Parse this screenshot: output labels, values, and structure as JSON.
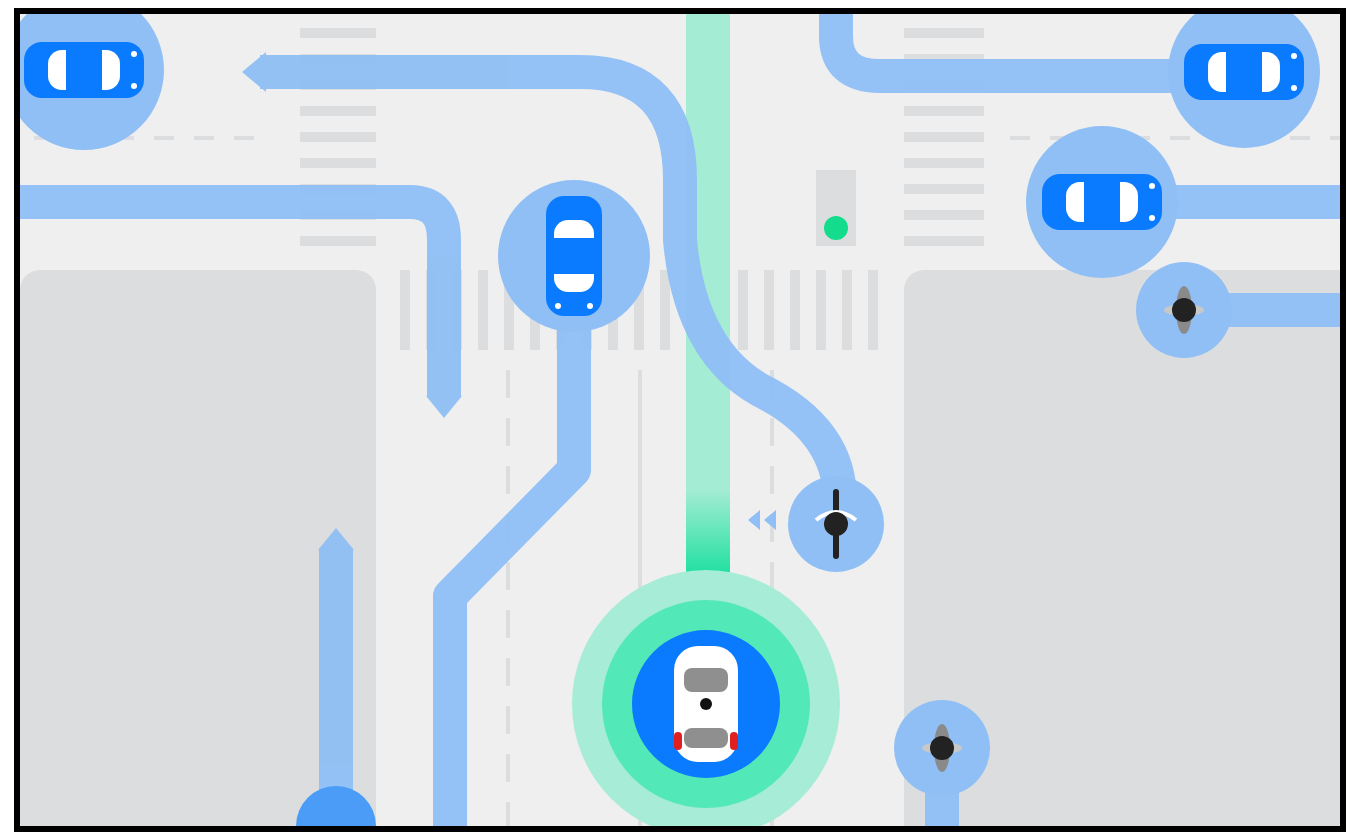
{
  "scene": {
    "agents": [
      {
        "kind": "car"
      },
      {
        "kind": "car"
      },
      {
        "kind": "car"
      },
      {
        "kind": "car"
      },
      {
        "kind": "pedestrian"
      },
      {
        "kind": "cyclist"
      },
      {
        "kind": "pedestrian"
      }
    ],
    "ego": {
      "kind": "self-driving-car"
    },
    "traffic_light": {
      "on": true
    }
  }
}
